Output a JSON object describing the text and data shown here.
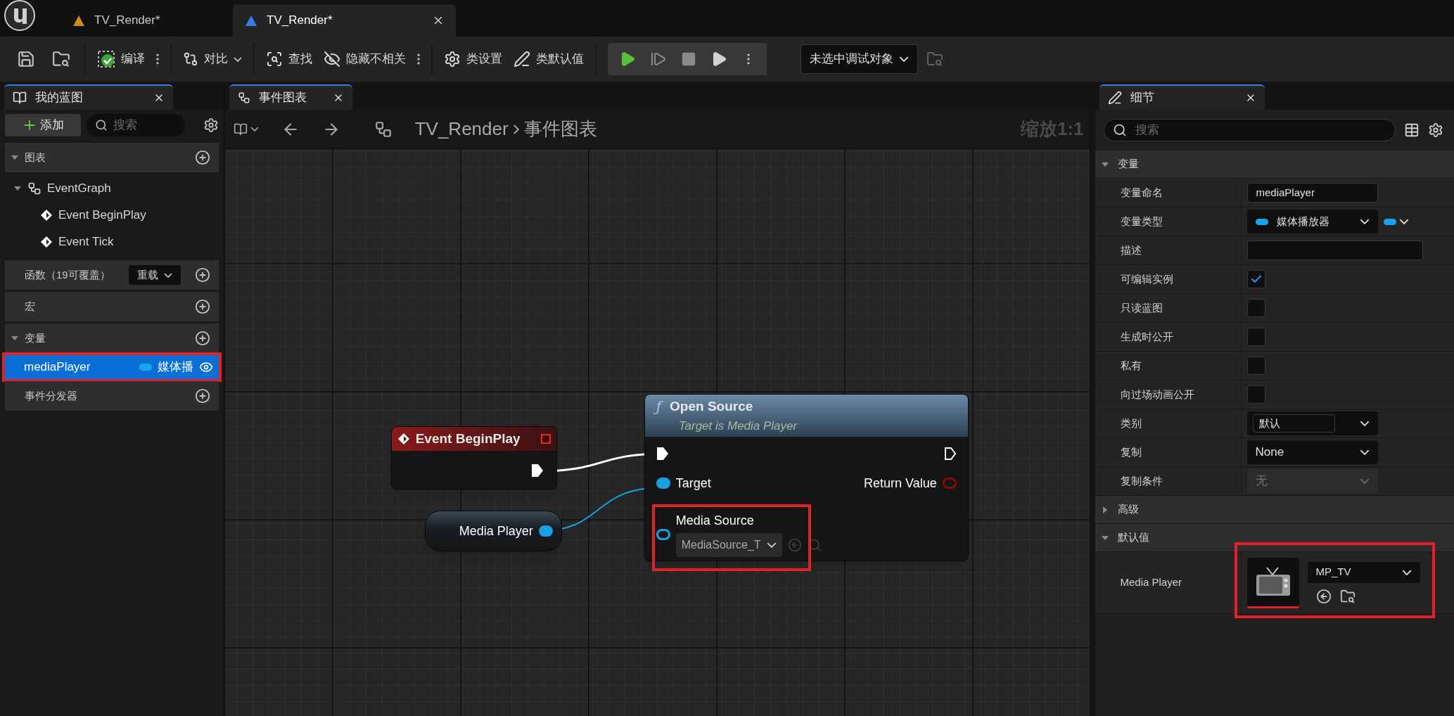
{
  "doc_tabs": [
    {
      "label": "TV_Render*",
      "selected": false,
      "color": "#d08a1a"
    },
    {
      "label": "TV_Render*",
      "selected": true,
      "color": "#3a7bf0"
    }
  ],
  "toolbar": {
    "compile": "编译",
    "diff": "对比",
    "find": "查找",
    "hide": "隐藏不相关",
    "class_settings": "类设置",
    "class_defaults": "类默认值",
    "debug_object": "未选中调试对象"
  },
  "my_blueprint": {
    "tab": "我的蓝图",
    "add": "添加",
    "search_placeholder": "搜索",
    "sections": [
      {
        "label": "图表",
        "expanded": true,
        "tree": [
          {
            "label": "EventGraph",
            "kind": "graph",
            "children": [
              {
                "label": "Event BeginPlay",
                "kind": "event"
              },
              {
                "label": "Event Tick",
                "kind": "event"
              }
            ]
          }
        ]
      },
      {
        "label": "函数（19可覆盖）",
        "dropdown": "重载"
      },
      {
        "label": "宏"
      },
      {
        "label": "变量",
        "expanded": true,
        "variables": [
          {
            "name": "mediaPlayer",
            "type": "媒体播",
            "selected": true,
            "highlighted": true
          }
        ]
      },
      {
        "label": "事件分发器"
      }
    ]
  },
  "graph": {
    "tab": "事件图表",
    "breadcrumb": [
      "TV_Render",
      "事件图表"
    ],
    "zoom": "缩放1:1",
    "event_node": {
      "title": "Event BeginPlay"
    },
    "variable_node": {
      "label": "Media Player"
    },
    "function_node": {
      "icon": "ƒ",
      "title": "Open Source",
      "subtitle": "Target is Media Player",
      "target": "Target",
      "return_value": "Return Value",
      "media_source": {
        "label": "Media Source",
        "value": "MediaSource_T",
        "highlighted": true
      }
    }
  },
  "details": {
    "tab": "细节",
    "search_placeholder": "搜索",
    "sections": [
      {
        "label": "变量",
        "expanded": true,
        "rows": [
          {
            "label": "变量命名",
            "kind": "text",
            "value": "mediaPlayer"
          },
          {
            "label": "变量类型",
            "kind": "type",
            "value": "媒体播放器"
          },
          {
            "label": "描述",
            "kind": "text"
          },
          {
            "label": "可编辑实例",
            "kind": "checkbox",
            "checked": true
          },
          {
            "label": "只读蓝图",
            "kind": "checkbox",
            "checked": false
          },
          {
            "label": "生成时公开",
            "kind": "checkbox",
            "checked": false
          },
          {
            "label": "私有",
            "kind": "checkbox",
            "checked": false
          },
          {
            "label": "向过场动画公开",
            "kind": "checkbox",
            "checked": false
          },
          {
            "label": "类别",
            "kind": "combo",
            "value": "默认"
          },
          {
            "label": "复制",
            "kind": "dropdown",
            "value": "None",
            "disabled": false
          },
          {
            "label": "复制条件",
            "kind": "dropdown",
            "value": "无",
            "disabled": true
          }
        ]
      },
      {
        "label": "高级",
        "expanded": false
      },
      {
        "label": "默认值",
        "expanded": true,
        "rows": [
          {
            "label": "Media Player",
            "kind": "asset",
            "value": "MP_TV",
            "highlighted": true
          }
        ]
      }
    ]
  }
}
